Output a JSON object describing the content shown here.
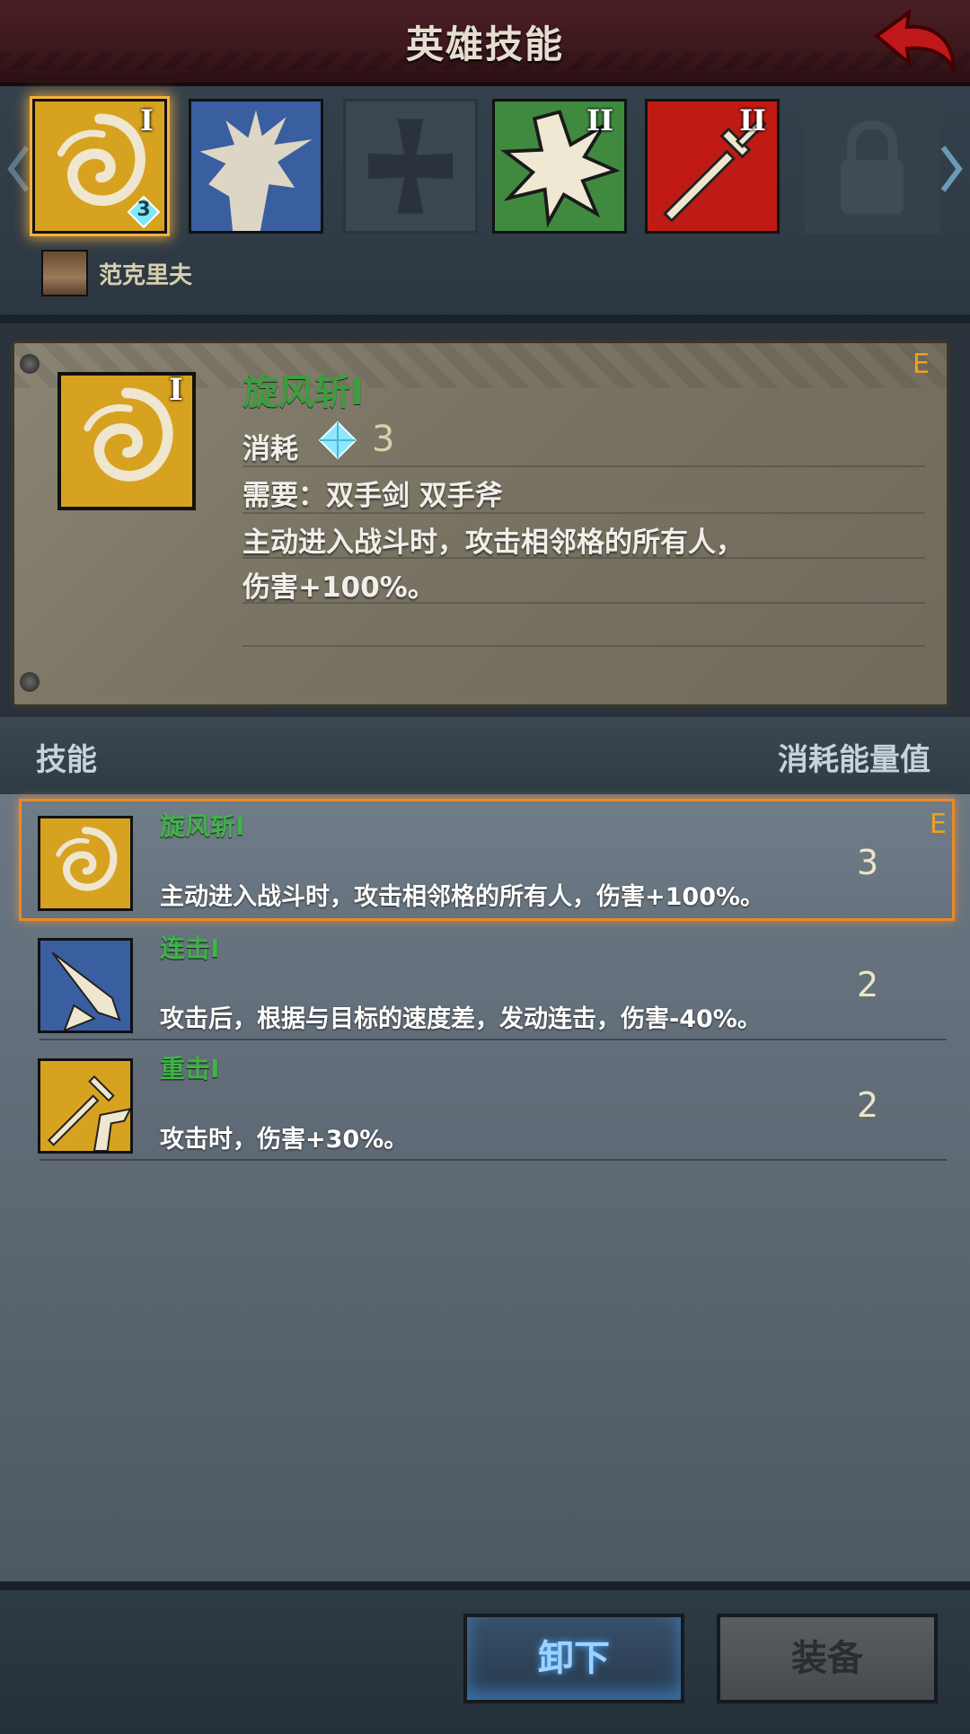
{
  "header": {
    "title": "英雄技能"
  },
  "slots": [
    {
      "roman": "I",
      "gem_count": "3",
      "icon": "whirlwind-icon",
      "color": "#d7a21f"
    },
    {
      "roman": "",
      "icon": "fist-icon",
      "color": "#3a5fa0"
    },
    {
      "roman": "",
      "icon": "empty-cross-slot-icon",
      "color": "#3a4650"
    },
    {
      "roman": "II",
      "icon": "burst-icon",
      "color": "#3f8a3f"
    },
    {
      "roman": "II",
      "icon": "sword-icon",
      "color": "#c01a14"
    },
    {
      "roman": "",
      "icon": "lock-icon",
      "color": "#34404a"
    }
  ],
  "hero": {
    "name": "范克里夫"
  },
  "detail": {
    "name": "旋风斩I",
    "roman": "I",
    "rank": "E",
    "cost_label": "消耗",
    "cost_value": "3",
    "requirement": "需要：双手剑  双手斧",
    "desc_line1": "主动进入战斗时，攻击相邻格的所有人，",
    "desc_line2": "伤害+100%。"
  },
  "list_header": {
    "skill": "技能",
    "cost": "消耗能量值"
  },
  "skills": [
    {
      "name": "旋风斩I",
      "desc": "主动进入战斗时，攻击相邻格的所有人，伤害+100%。",
      "cost": "3",
      "rank": "E",
      "icon": "whirlwind-icon"
    },
    {
      "name": "连击I",
      "desc": "攻击后，根据与目标的速度差，发动连击，伤害-40%。",
      "cost": "2",
      "icon": "double-blade-icon"
    },
    {
      "name": "重击I",
      "desc": "攻击时，伤害+30%。",
      "cost": "2",
      "icon": "heavy-strike-icon"
    }
  ],
  "buttons": {
    "unequip": "卸下",
    "equip": "装备"
  }
}
